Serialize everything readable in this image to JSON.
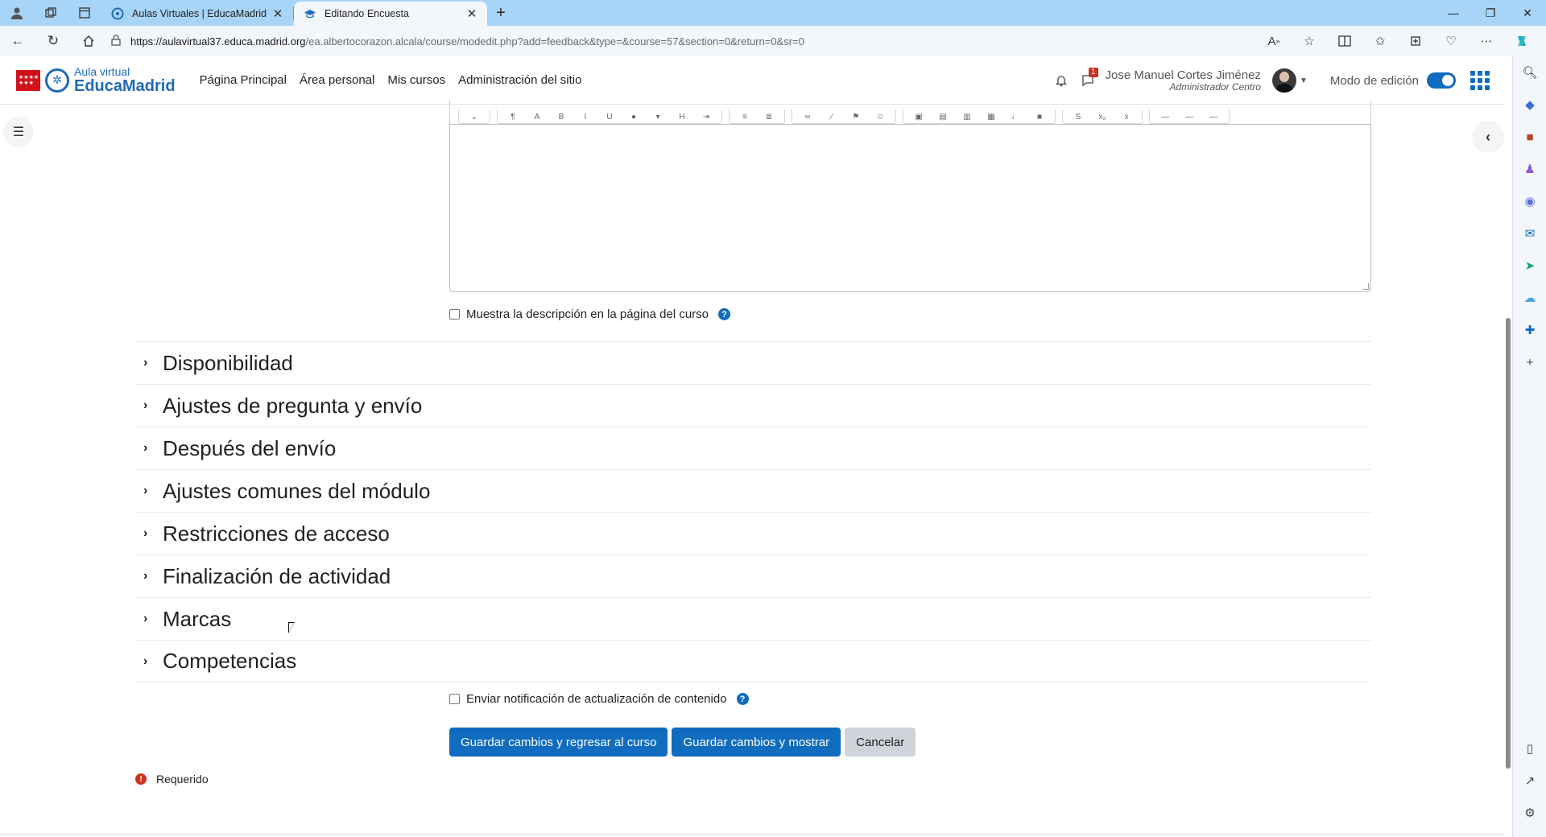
{
  "browser": {
    "tabs": [
      {
        "title": "Aulas Virtuales | EducaMadrid",
        "active": false
      },
      {
        "title": "Editando Encuesta",
        "active": true
      }
    ],
    "url_host": "https://aulavirtual37.educa.madrid.org",
    "url_path": "/ea.albertocorazon.alcala/course/modedit.php?add=feedback&type=&course=57&section=0&return=0&sr=0"
  },
  "navbar": {
    "logo_line1": "Aula virtual",
    "logo_line2": "EducaMadrid",
    "menu": [
      "Página Principal",
      "Área personal",
      "Mis cursos",
      "Administración del sitio"
    ],
    "notification_count": "1",
    "user_name": "Jose Manuel Cortes Jiménez",
    "user_role": "Administrador Centro",
    "edit_mode_label": "Modo de edición",
    "edit_mode_on": true
  },
  "form": {
    "show_description_label": "Muestra la descripción en la página del curso",
    "sections": [
      "Disponibilidad",
      "Ajustes de pregunta y envío",
      "Después del envío",
      "Ajustes comunes del módulo",
      "Restricciones de acceso",
      "Finalización de actividad",
      "Marcas",
      "Competencias"
    ],
    "notify_label": "Enviar notificación de actualización de contenido",
    "buttons": {
      "save_return": "Guardar cambios y regresar al curso",
      "save_display": "Guardar cambios y mostrar",
      "cancel": "Cancelar"
    },
    "required_label": "Requerido"
  },
  "colors": {
    "primary": "#0f6cbf",
    "danger": "#ca3120",
    "tabbar": "#a8d4f7"
  }
}
